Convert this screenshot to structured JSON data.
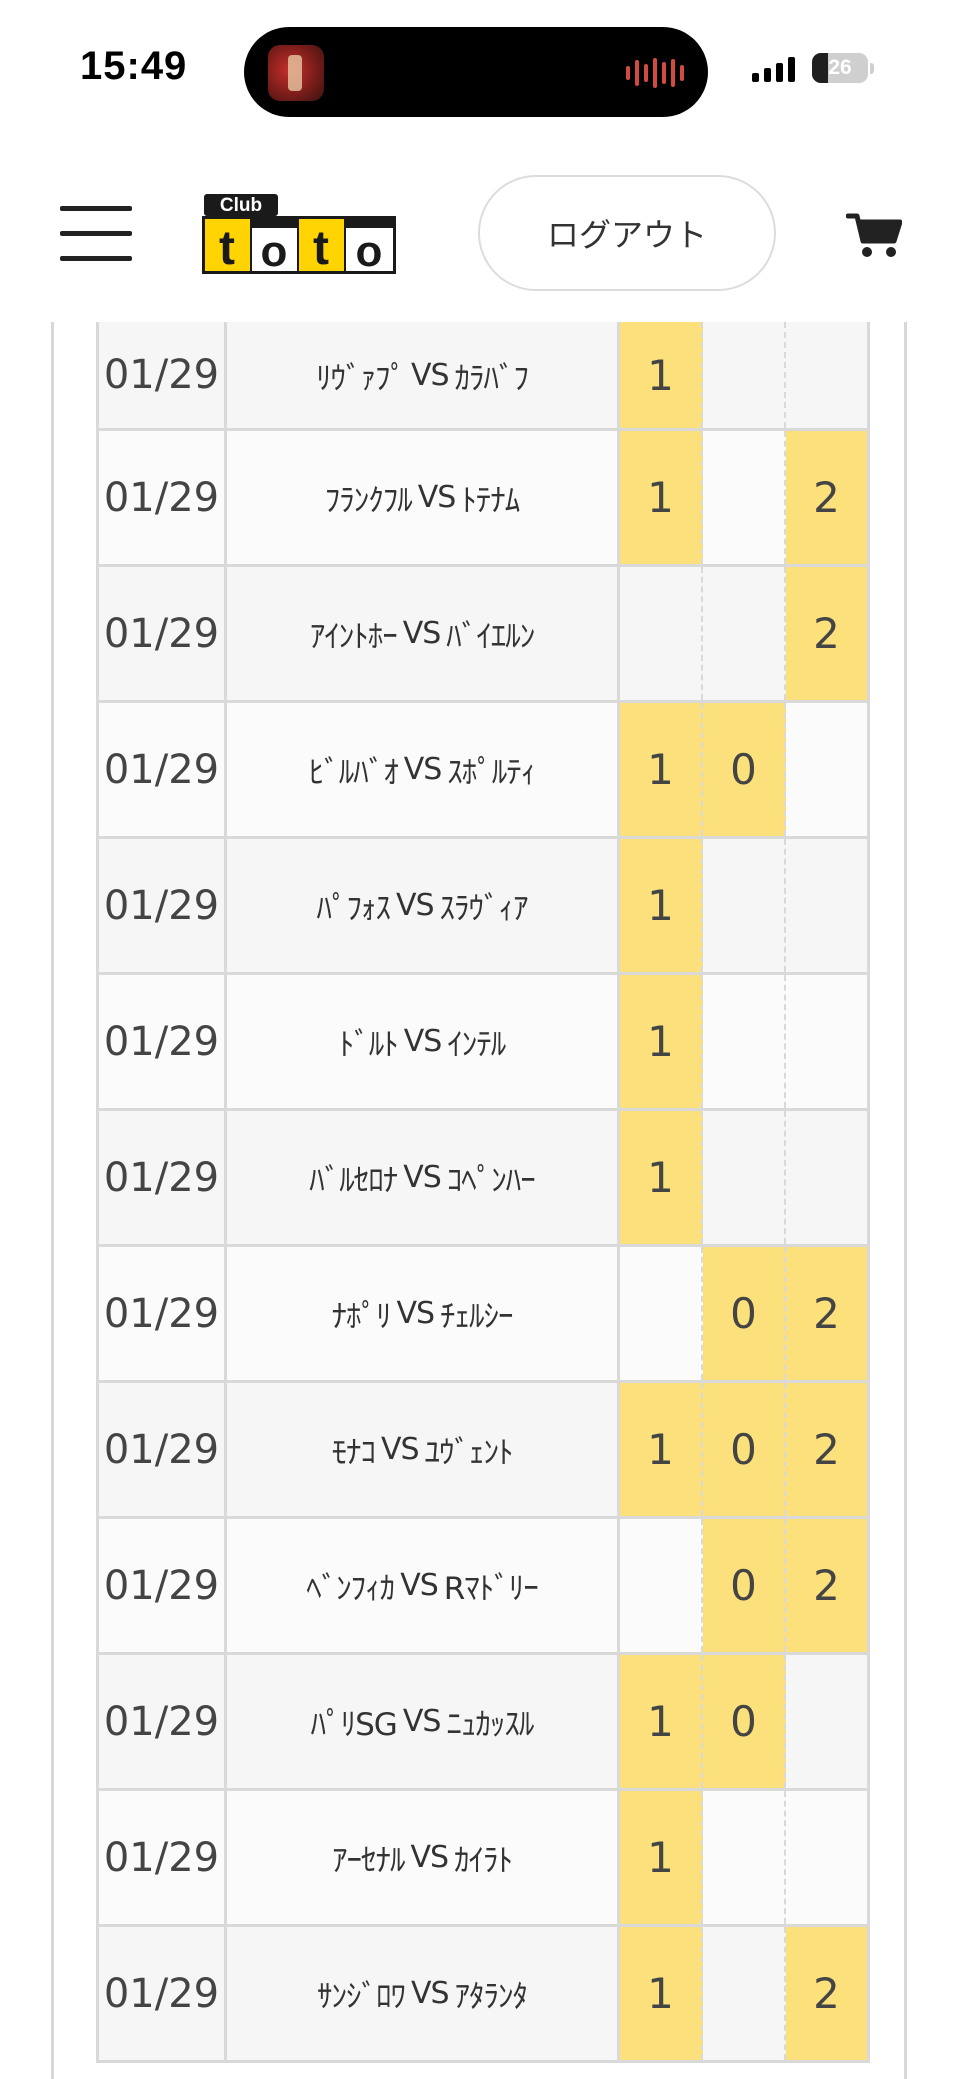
{
  "status_bar": {
    "time": "15:49",
    "battery": "26"
  },
  "header": {
    "logo_text_small": "Club",
    "logo_text_large": "toto",
    "logout_label": "ログアウト",
    "menu_icon": "hamburger-menu-icon",
    "cart_icon": "shopping-cart-icon"
  },
  "colors": {
    "selected_pick": "#fbe07c",
    "logo_yellow": "#ffd400"
  },
  "matches": [
    {
      "date": "01/29",
      "home": "ﾘｳﾞｧﾌﾟ",
      "vs": "VS",
      "away": "ｶﾗﾊﾞﾌ",
      "picks": {
        "1": true,
        "0": false,
        "2": false
      }
    },
    {
      "date": "01/29",
      "home": "ﾌﾗﾝｸﾌﾙ",
      "vs": "VS",
      "away": "ﾄﾃﾅﾑ",
      "picks": {
        "1": true,
        "0": false,
        "2": true
      }
    },
    {
      "date": "01/29",
      "home": "ｱｲﾝﾄﾎｰ",
      "vs": "VS",
      "away": "ﾊﾞｲｴﾙﾝ",
      "picks": {
        "1": false,
        "0": false,
        "2": true
      }
    },
    {
      "date": "01/29",
      "home": "ﾋﾞﾙﾊﾞｵ",
      "vs": "VS",
      "away": "ｽﾎﾟﾙﾃｨ",
      "picks": {
        "1": true,
        "0": true,
        "2": false
      }
    },
    {
      "date": "01/29",
      "home": "ﾊﾟﾌｫｽ",
      "vs": "VS",
      "away": "ｽﾗｳﾞｨｱ",
      "picks": {
        "1": true,
        "0": false,
        "2": false
      }
    },
    {
      "date": "01/29",
      "home": "ﾄﾞﾙﾄ",
      "vs": "VS",
      "away": "ｲﾝﾃﾙ",
      "picks": {
        "1": true,
        "0": false,
        "2": false
      }
    },
    {
      "date": "01/29",
      "home": "ﾊﾞﾙｾﾛﾅ",
      "vs": "VS",
      "away": "ｺﾍﾟﾝﾊｰ",
      "picks": {
        "1": true,
        "0": false,
        "2": false
      }
    },
    {
      "date": "01/29",
      "home": "ﾅﾎﾟﾘ",
      "vs": "VS",
      "away": "ﾁｪﾙｼｰ",
      "picks": {
        "1": false,
        "0": true,
        "2": true
      }
    },
    {
      "date": "01/29",
      "home": "ﾓﾅｺ",
      "vs": "VS",
      "away": "ﾕｳﾞｪﾝﾄ",
      "picks": {
        "1": true,
        "0": true,
        "2": true
      }
    },
    {
      "date": "01/29",
      "home": "ﾍﾞﾝﾌｨｶ",
      "vs": "VS",
      "away": "Rﾏﾄﾞﾘｰ",
      "picks": {
        "1": false,
        "0": true,
        "2": true
      }
    },
    {
      "date": "01/29",
      "home": "ﾊﾟﾘSG",
      "vs": "VS",
      "away": "ﾆｭｶｯｽﾙ",
      "picks": {
        "1": true,
        "0": true,
        "2": false
      }
    },
    {
      "date": "01/29",
      "home": "ｱｰｾﾅﾙ",
      "vs": "VS",
      "away": "ｶｲﾗﾄ",
      "picks": {
        "1": true,
        "0": false,
        "2": false
      }
    },
    {
      "date": "01/29",
      "home": "ｻﾝｼﾞﾛﾜ",
      "vs": "VS",
      "away": "ｱﾀﾗﾝﾀ",
      "picks": {
        "1": true,
        "0": false,
        "2": true
      }
    }
  ],
  "pick_labels": [
    "1",
    "0",
    "2"
  ]
}
